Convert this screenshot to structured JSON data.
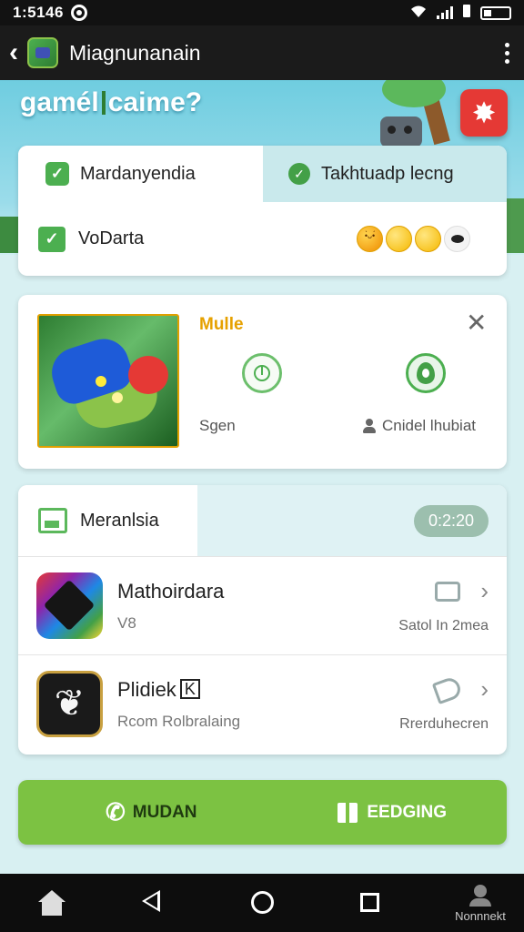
{
  "status_bar": {
    "time": "1:5146"
  },
  "app_bar": {
    "title": "Miagnunanain"
  },
  "hero": {
    "headline_part1": "gamél",
    "headline_part2": "caime?"
  },
  "tabs": [
    {
      "label": "Mardanyendia",
      "active": true
    },
    {
      "label": "Takhtuadp lecng",
      "active": false
    }
  ],
  "tab_body": {
    "label": "VoDarta"
  },
  "mode_card": {
    "title": "Mulle",
    "sub_left": "Sgen",
    "sub_right": "Cnidel lhubiat"
  },
  "list_card": {
    "header_title": "Meranlsia",
    "time_pill": "0:2:20",
    "items": [
      {
        "title": "Mathoirdara",
        "subtitle": "V8",
        "meta": "Satol In 2mea"
      },
      {
        "title": "Plidiek",
        "pin": "K",
        "subtitle": "Rcom Rolbralaing",
        "meta": "Rrerduhecren"
      }
    ]
  },
  "cta": {
    "left_label": "MUDAN",
    "right_label": "EEDGING"
  },
  "nav_bar": {
    "user_label": "Nonnnekt"
  },
  "colors": {
    "accent_green": "#7cc242",
    "check_green": "#4caf50",
    "title_orange": "#e6a100",
    "hero_badge_red": "#e53935"
  }
}
